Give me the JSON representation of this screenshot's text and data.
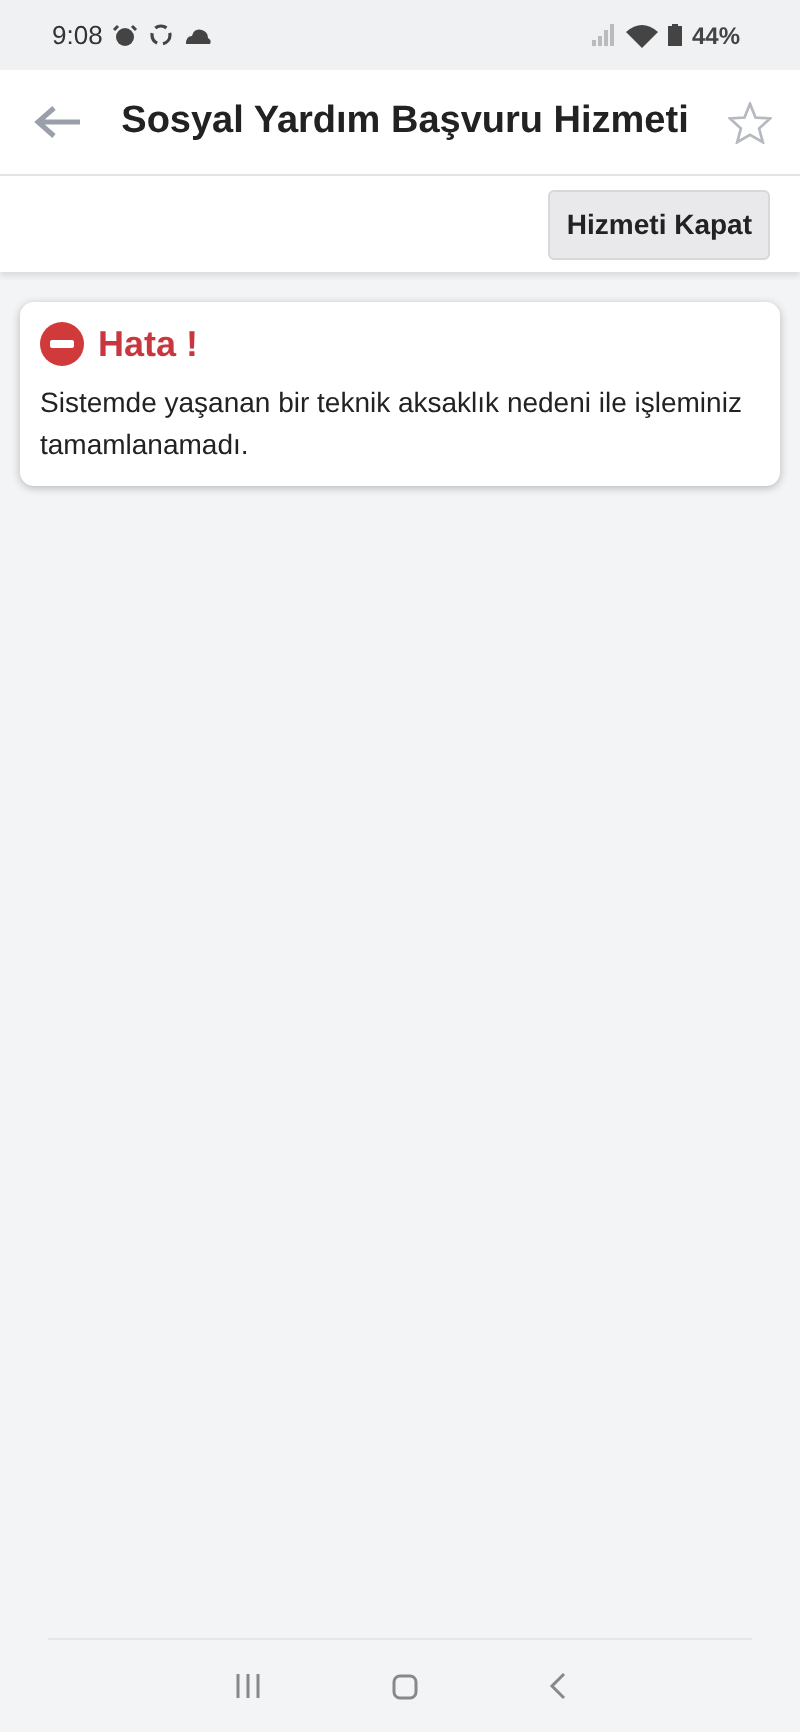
{
  "status_bar": {
    "time": "9:08",
    "battery": "44%"
  },
  "header": {
    "title": "Sosyal Yardım Başvuru Hizmeti",
    "favorite": false
  },
  "toolbar": {
    "buttons": [
      "Hizmeti Kapat"
    ]
  },
  "alert": {
    "title": "Hata !",
    "message": "Sistemde yaşanan bir teknik aksaklık nedeni ile işleminiz tamamlanamadı."
  }
}
